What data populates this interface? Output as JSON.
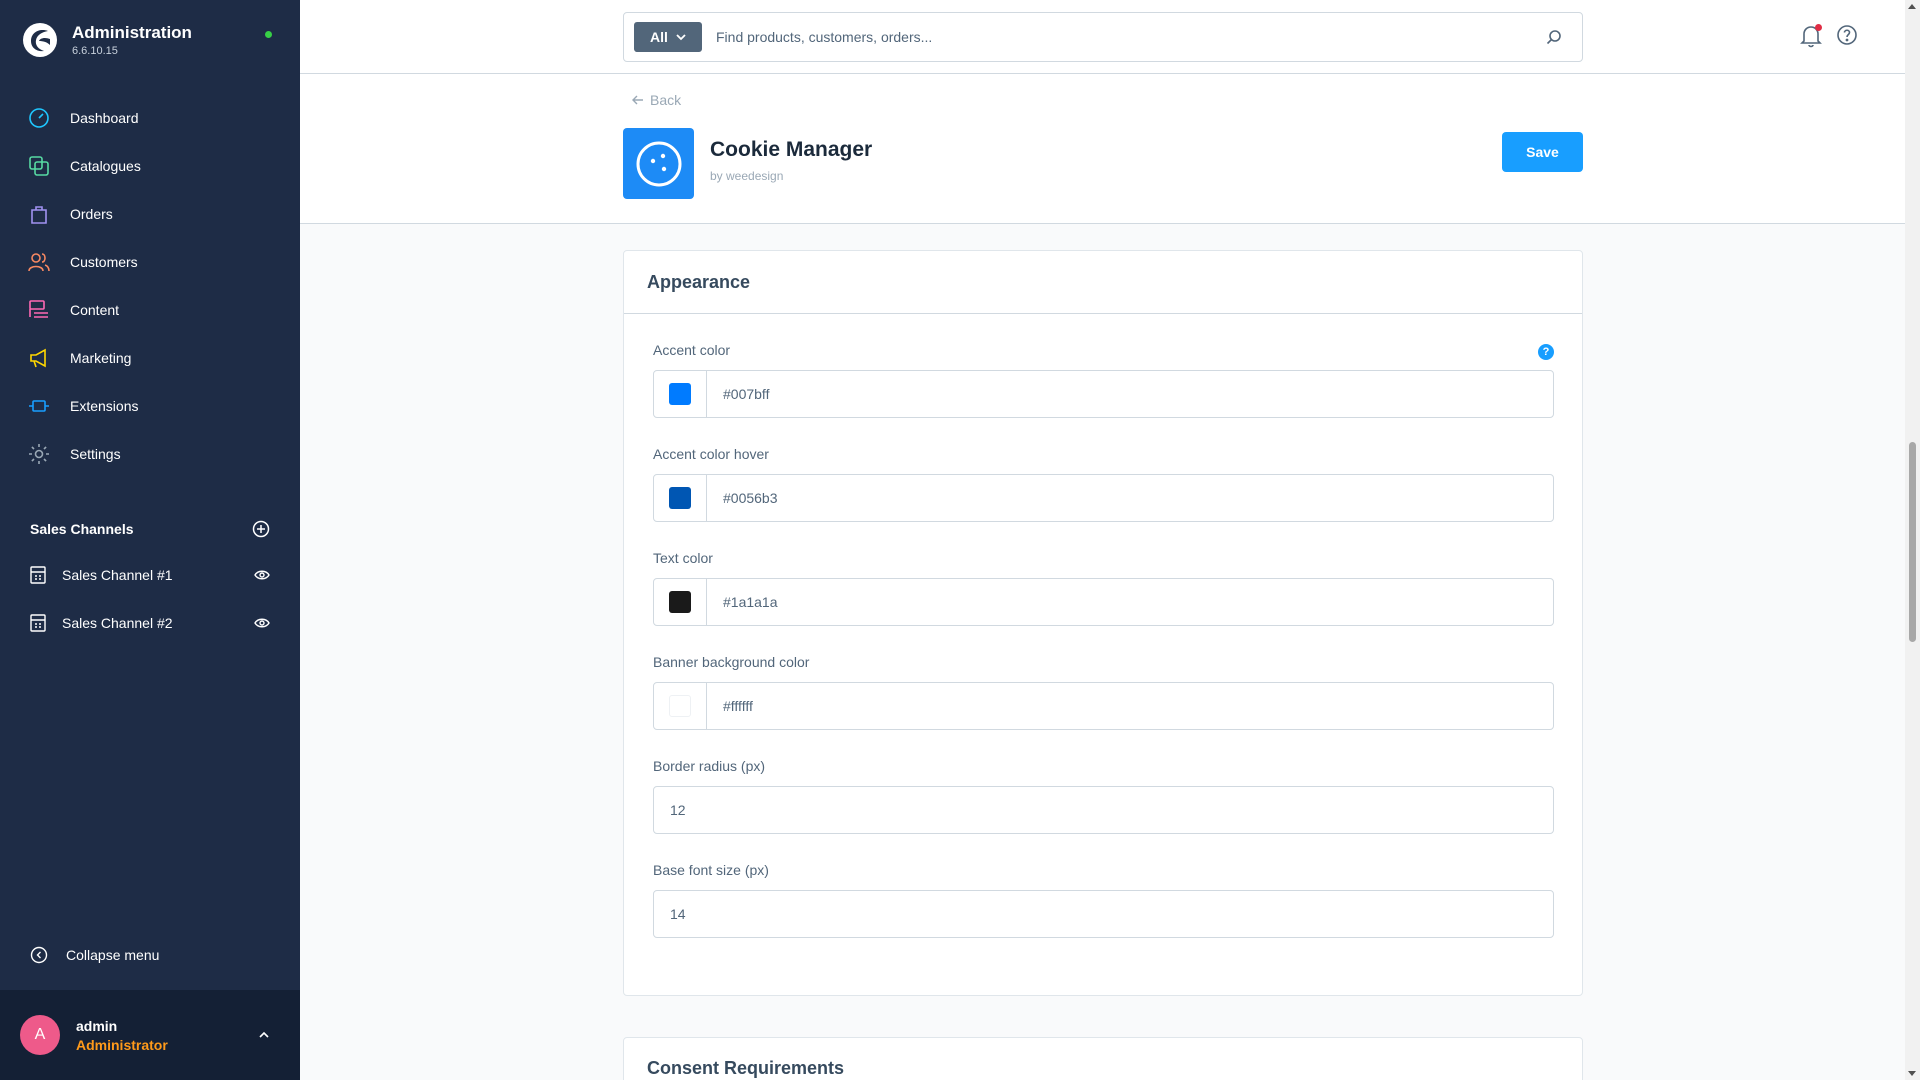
{
  "brand": {
    "title": "Administration",
    "version": "6.6.10.15"
  },
  "nav": [
    {
      "label": "Dashboard",
      "icon": "dashboard-icon",
      "color": "#1ec7ff"
    },
    {
      "label": "Catalogues",
      "icon": "catalogues-icon",
      "color": "#57d9a3"
    },
    {
      "label": "Orders",
      "icon": "orders-icon",
      "color": "#a092f0"
    },
    {
      "label": "Customers",
      "icon": "customers-icon",
      "color": "#f88962"
    },
    {
      "label": "Content",
      "icon": "content-icon",
      "color": "#ff68b4"
    },
    {
      "label": "Marketing",
      "icon": "marketing-icon",
      "color": "#ffd700"
    },
    {
      "label": "Extensions",
      "icon": "extensions-icon",
      "color": "#189eff"
    },
    {
      "label": "Settings",
      "icon": "settings-icon",
      "color": "#9aa8b5"
    }
  ],
  "sales_channels": {
    "title": "Sales Channels",
    "items": [
      {
        "label": "Sales Channel #1"
      },
      {
        "label": "Sales Channel #2"
      }
    ]
  },
  "collapse_label": "Collapse menu",
  "user": {
    "initial": "A",
    "name": "admin",
    "role": "Administrator"
  },
  "search": {
    "type": "All",
    "placeholder": "Find products, customers, orders..."
  },
  "page": {
    "back_label": "Back",
    "app_title": "Cookie Manager",
    "app_vendor": "by weedesign",
    "save_label": "Save"
  },
  "appearance": {
    "title": "Appearance",
    "help": "?",
    "fields": {
      "accent_color": {
        "label": "Accent color",
        "value": "#007bff"
      },
      "accent_color_hover": {
        "label": "Accent color hover",
        "value": "#0056b3"
      },
      "text_color": {
        "label": "Text color",
        "value": "#1a1a1a"
      },
      "banner_bg_color": {
        "label": "Banner background color",
        "value": "#ffffff"
      },
      "border_radius": {
        "label": "Border radius (px)",
        "value": "12"
      },
      "base_font_size": {
        "label": "Base font size (px)",
        "value": "14"
      }
    }
  },
  "consent": {
    "title": "Consent Requirements"
  }
}
